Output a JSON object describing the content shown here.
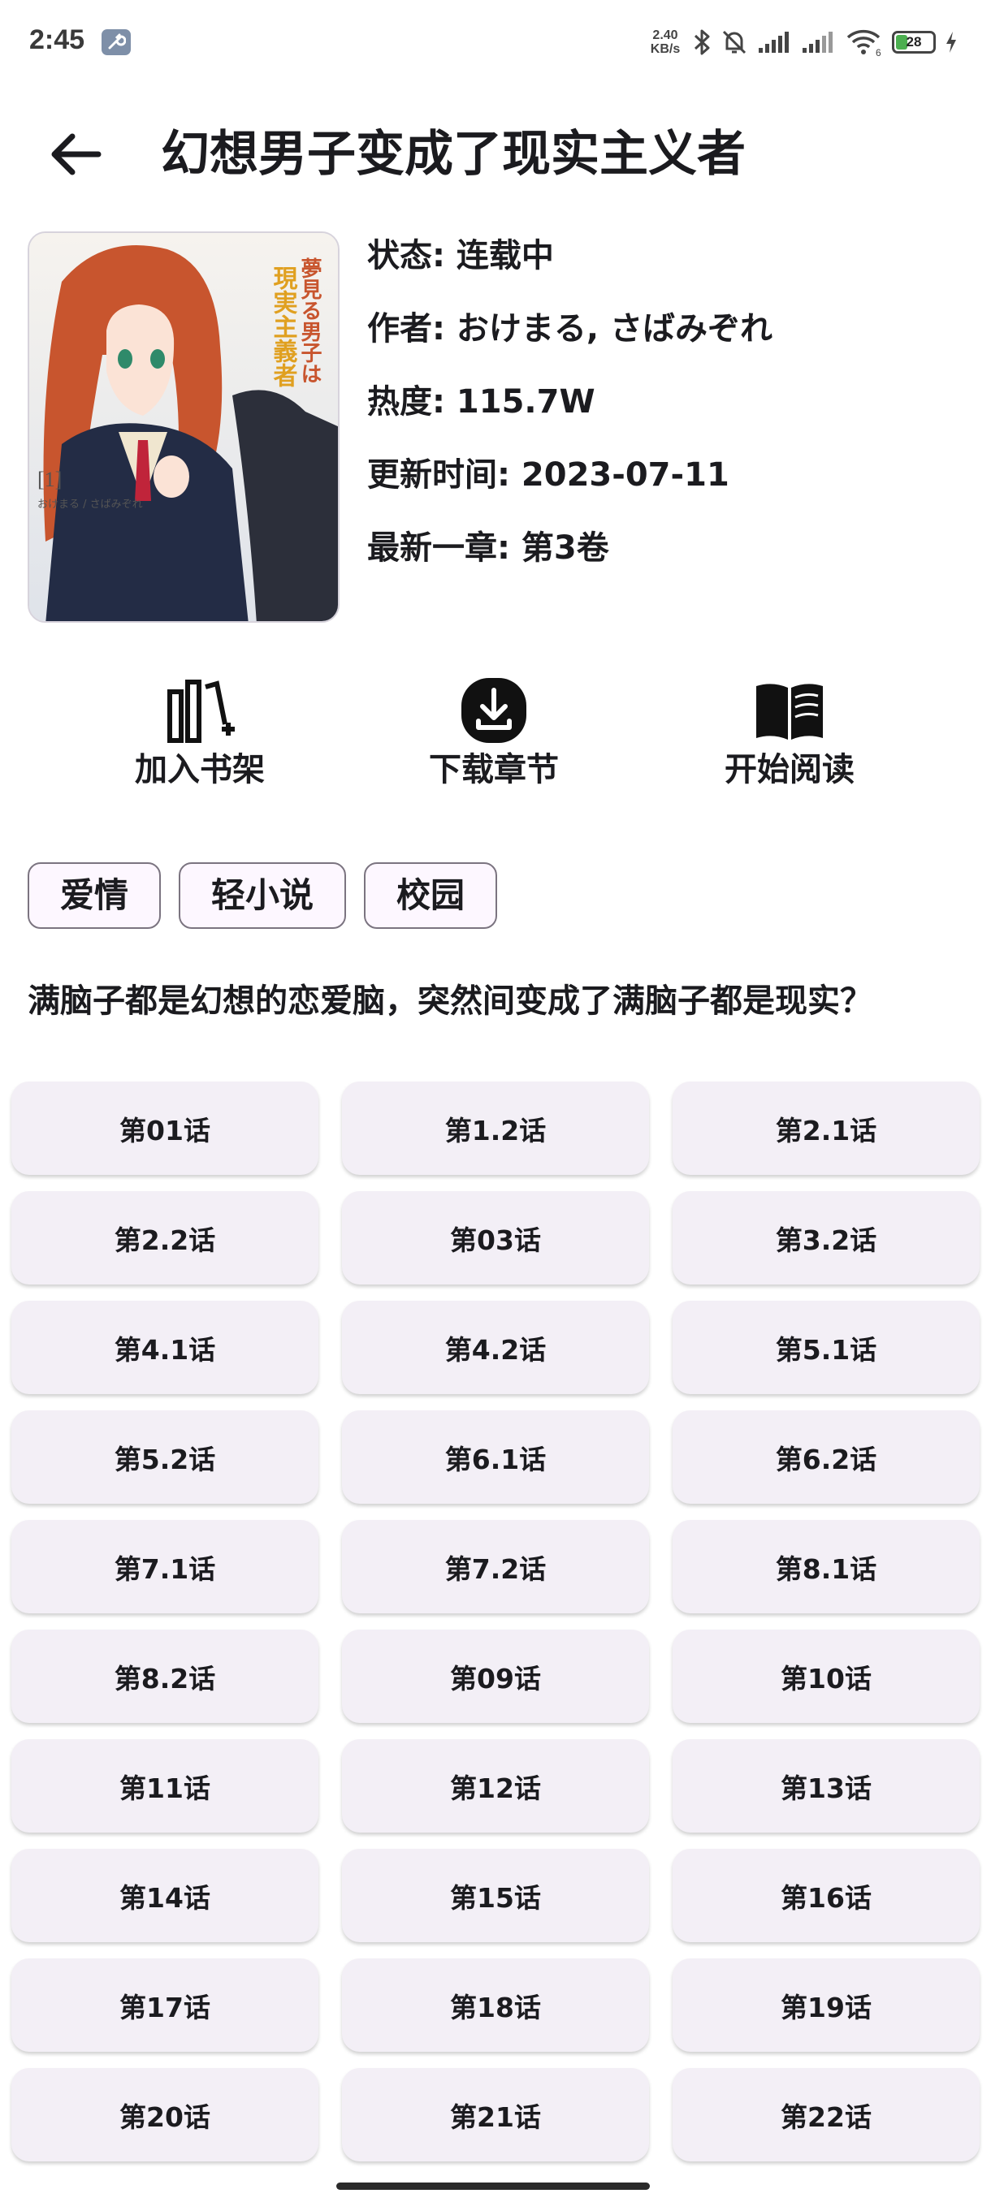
{
  "status_bar": {
    "time": "2:45",
    "net_speed_value": "2.40",
    "net_speed_unit": "KB/s",
    "wifi_badge": "6",
    "battery": "28",
    "icons": [
      "wrench-icon",
      "bluetooth-icon",
      "bell-off-icon",
      "signal-icon",
      "signal-icon",
      "wifi-icon",
      "battery-icon",
      "charging-icon"
    ]
  },
  "header": {
    "title": "幻想男子变成了现实主义者"
  },
  "book": {
    "cover_title": "夢見る男子は現実主義者",
    "cover_volume": "[1]",
    "cover_authors": "おけまる / さばみぞれ",
    "status": "状态: 连载中",
    "author": "作者: おけまる, さばみぞれ",
    "popularity": "热度: 115.7W",
    "updated": "更新时间: 2023-07-11",
    "latest": "最新一章: 第3卷"
  },
  "actions": [
    {
      "label": "加入书架",
      "icon": "add-bookshelf-icon"
    },
    {
      "label": "下载章节",
      "icon": "download-icon"
    },
    {
      "label": "开始阅读",
      "icon": "open-book-icon"
    }
  ],
  "tags": [
    "爱情",
    "轻小说",
    "校园"
  ],
  "description": "满脑子都是幻想的恋爱脑，突然间变成了满脑子都是现实？",
  "chapters": [
    "第01话",
    "第1.2话",
    "第2.1话",
    "第2.2话",
    "第03话",
    "第3.2话",
    "第4.1话",
    "第4.2话",
    "第5.1话",
    "第5.2话",
    "第6.1话",
    "第6.2话",
    "第7.1话",
    "第7.2话",
    "第8.1话",
    "第8.2话",
    "第09话",
    "第10话",
    "第11话",
    "第12话",
    "第13话",
    "第14话",
    "第15话",
    "第16话",
    "第17话",
    "第18话",
    "第19话",
    "第20话",
    "第21话",
    "第22话"
  ],
  "colors": {
    "chapter_bg": "#f3eff6",
    "tag_bg": "#fdf7ff",
    "tag_border": "#7b7480",
    "text": "#1b1b1f"
  }
}
